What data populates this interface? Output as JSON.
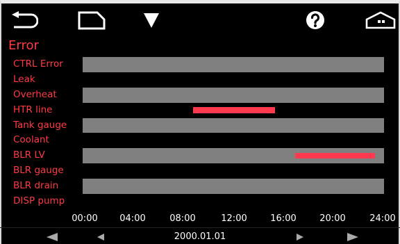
{
  "header": {
    "icons": [
      "back-icon",
      "page-icon",
      "dropdown-triangle-icon",
      "help-icon",
      "home-icon"
    ]
  },
  "title": "Error",
  "rows": [
    {
      "label": "CTRL Error"
    },
    {
      "label": "Leak"
    },
    {
      "label": "Overheat"
    },
    {
      "label": "HTR line"
    },
    {
      "label": "Tank gauge"
    },
    {
      "label": "Coolant"
    },
    {
      "label": "BLR LV"
    },
    {
      "label": "BLR gauge"
    },
    {
      "label": "BLR drain"
    },
    {
      "label": "DISP pump"
    }
  ],
  "time_axis": {
    "ticks": [
      "00:00",
      "04:00",
      "08:00",
      "12:00",
      "16:00",
      "20:00",
      "24:00"
    ],
    "range_hours": [
      0,
      24
    ]
  },
  "events": [
    {
      "row": "HTR line",
      "start_hour": 8.8,
      "end_hour": 15.3
    },
    {
      "row": "BLR LV",
      "start_hour": 16.9,
      "end_hour": 23.3
    }
  ],
  "date": "2000.01.01",
  "colors": {
    "label": "#ff3a46",
    "event": "#ff3a4f",
    "band": "#808080"
  }
}
